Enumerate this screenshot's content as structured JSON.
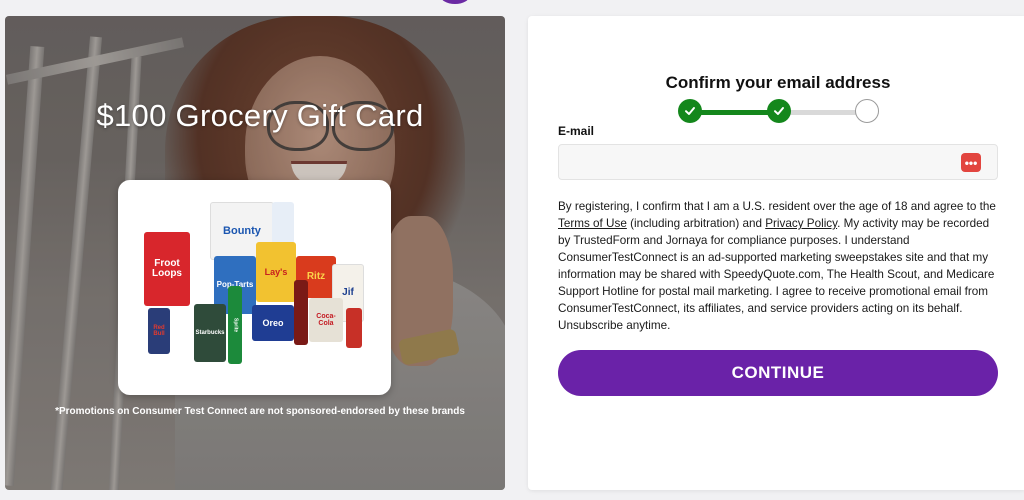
{
  "promo": {
    "title": "$100 Grocery Gift Card",
    "disclaimer": "*Promotions on Consumer Test Connect are not sponsored-endorsed by these brands"
  },
  "products": {
    "items": [
      "Froot Loops",
      "Bounty",
      "Pop-Tarts",
      "Lay's",
      "Ritz",
      "Jif",
      "Oreo",
      "Coca-Cola",
      "Red Bull",
      "Sprite",
      "Starbucks"
    ]
  },
  "form": {
    "heading": "Confirm your email address",
    "steps": [
      {
        "state": "complete"
      },
      {
        "state": "complete"
      },
      {
        "state": "pending"
      }
    ],
    "email_label": "E-mail",
    "email_value": "",
    "email_placeholder": "",
    "legal": {
      "part1": "By registering, I confirm that I am a U.S. resident over the age of 18 and agree to the ",
      "terms_link": "Terms of Use",
      "part2": " (including arbitration) and ",
      "privacy_link": "Privacy Policy",
      "part3": ". My activity may be recorded by TrustedForm and Jornaya for compliance purposes. I understand ConsumerTestConnect is an ad-supported marketing sweepstakes site and that my information may be shared with SpeedyQuote.com, The Health Scout, and Medicare Support Hotline for postal mail marketing. I agree to receive promotional email from ConsumerTestConnect, its affiliates, and service providers acting on its behalf. Unsubscribe anytime."
    },
    "continue_label": "CONTINUE"
  },
  "colors": {
    "accent": "#6a22a8",
    "step_complete": "#14871c",
    "password_icon": "#e2453f"
  },
  "icons": {
    "step_check": "check-icon",
    "password_manager": "password-manager-icon"
  }
}
